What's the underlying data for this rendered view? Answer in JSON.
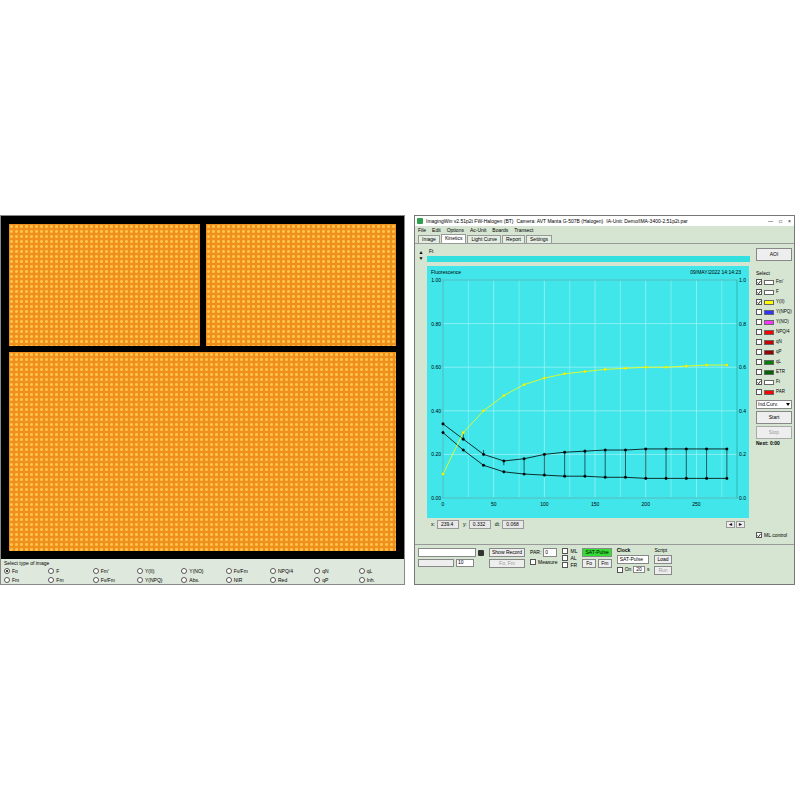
{
  "image_panel": {
    "select_label": "Select type of image",
    "options": [
      {
        "label": "Fo",
        "selected": true
      },
      {
        "label": "F",
        "selected": false
      },
      {
        "label": "Fm'",
        "selected": false
      },
      {
        "label": "Y(II)",
        "selected": false
      },
      {
        "label": "Y(NO)",
        "selected": false
      },
      {
        "label": "Fv/Fm",
        "selected": false
      },
      {
        "label": "NPQ/4",
        "selected": false
      },
      {
        "label": "qN",
        "selected": false
      },
      {
        "label": "qL",
        "selected": false
      },
      {
        "label": "Fm",
        "selected": false
      },
      {
        "label": "Fm",
        "selected": false
      },
      {
        "label": "Fv/Fm",
        "selected": false
      },
      {
        "label": "Y(NPQ)",
        "selected": false
      },
      {
        "label": "Abs.",
        "selected": false
      },
      {
        "label": "NIR",
        "selected": false
      },
      {
        "label": "Red",
        "selected": false
      },
      {
        "label": "qP",
        "selected": false
      },
      {
        "label": "Inh.",
        "selected": false
      }
    ]
  },
  "window": {
    "title": "ImagingWin v2.51p2t FW-Halogen (BT)",
    "camera": "Camera: AVT Manta G-507B (Halogen)",
    "unit": "IA-Unit: Demo/IMA-3400-2.51p2t.par",
    "window_buttons": [
      "—",
      "□",
      "×"
    ]
  },
  "menu": [
    "File",
    "Edit",
    "Options",
    "Ac-Unit",
    "Boards",
    "Transect"
  ],
  "tabs": [
    {
      "label": "Image",
      "selected": false
    },
    {
      "label": "Kinetics",
      "selected": true
    },
    {
      "label": "Light Curve",
      "selected": false
    },
    {
      "label": "Report",
      "selected": false
    },
    {
      "label": "Settings",
      "selected": false
    }
  ],
  "spin": [
    "▲",
    "▼"
  ],
  "curve_label": "Ft",
  "chart": {
    "title": "Fluorescence",
    "timestamp": "09/MAY/2022  14:14:23",
    "y_ticks_left": [
      "0.00",
      "0.20",
      "0.40",
      "0.60",
      "0.80",
      "1.00"
    ],
    "y_ticks_right": [
      "0.0",
      "0.2",
      "0.4",
      "0.6",
      "0.8",
      "1.0"
    ],
    "x_ticks": [
      "0",
      "50",
      "100",
      "150",
      "200",
      "250"
    ],
    "x_values": [
      0,
      20,
      40,
      60,
      80,
      100,
      120,
      140,
      160,
      180,
      200,
      220,
      240,
      260,
      280
    ],
    "series": [
      {
        "name": "Fm'",
        "color": "#000000",
        "values": [
          0.34,
          0.27,
          0.2,
          0.17,
          0.18,
          0.2,
          0.21,
          0.215,
          0.22,
          0.22,
          0.225,
          0.225,
          0.225,
          0.225,
          0.225
        ]
      },
      {
        "name": "F",
        "color": "#000000",
        "values": [
          0.3,
          0.22,
          0.15,
          0.12,
          0.11,
          0.105,
          0.1,
          0.1,
          0.095,
          0.095,
          0.09,
          0.09,
          0.09,
          0.09,
          0.09
        ]
      },
      {
        "name": "Y(II)",
        "color": "#ffff00",
        "values": [
          0.11,
          0.3,
          0.4,
          0.47,
          0.52,
          0.55,
          0.57,
          0.58,
          0.59,
          0.595,
          0.6,
          0.6,
          0.605,
          0.61,
          0.61
        ]
      }
    ]
  },
  "readouts": [
    {
      "label": "x:",
      "value": "239.4"
    },
    {
      "label": "y:",
      "value": "0.332"
    },
    {
      "label": "dt:",
      "value": "0.068"
    }
  ],
  "scroll_buttons": [
    "◄",
    "►"
  ],
  "aoi_button": "AOI",
  "select": {
    "label": "Select",
    "items": [
      {
        "label": "Fm'",
        "checked": true,
        "color": "#ffffff"
      },
      {
        "label": "F",
        "checked": true,
        "color": "#ffffff"
      },
      {
        "label": "Y(II)",
        "checked": true,
        "color": "#ffff00"
      },
      {
        "label": "Y(NPQ)",
        "checked": false,
        "color": "#3333ff"
      },
      {
        "label": "Y(NO)",
        "checked": false,
        "color": "#ff33ff"
      },
      {
        "label": "NPQ/4",
        "checked": false,
        "color": "#ff0000"
      },
      {
        "label": "qN",
        "checked": false,
        "color": "#cc0000"
      },
      {
        "label": "qP",
        "checked": false,
        "color": "#990000"
      },
      {
        "label": "qL",
        "checked": false,
        "color": "#008000"
      },
      {
        "label": "ETR",
        "checked": false,
        "color": "#006400"
      },
      {
        "label": "Ft",
        "checked": true,
        "color": "#ffffff"
      },
      {
        "label": "PAR",
        "checked": false,
        "color": "#ff0000"
      }
    ]
  },
  "ind_curve": "Ind.Curv.",
  "start": "Start",
  "stop": {
    "label": "Stop",
    "disabled": true
  },
  "next": "Next: 0:00",
  "ml_control": {
    "label": "ML control",
    "checked": true
  },
  "controls": {
    "record_field": "",
    "count_field": "10",
    "show_record": "Show Record",
    "fo_fm": {
      "label": "Fo, Fm",
      "disabled": true
    },
    "par_label": "PAR:",
    "par_value": "0",
    "measure": {
      "label": "Measure",
      "checked": false
    },
    "light_checks": [
      {
        "label": "ML",
        "checked": false
      },
      {
        "label": "AL",
        "checked": false
      },
      {
        "label": "FR",
        "checked": false
      }
    ],
    "sat_pulse": "SAT-Pulse",
    "fo_button": "Fo",
    "fm_button": "Fm",
    "clock_label": "Clock",
    "clock_mode": "SAT-Pulse",
    "clock_on": {
      "label": "On",
      "checked": false
    },
    "clock_interval": "20",
    "clock_unit": "s",
    "script_label": "Script",
    "load": "Load",
    "run": {
      "label": "Run",
      "disabled": true
    }
  }
}
